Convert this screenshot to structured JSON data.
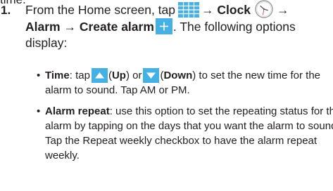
{
  "top_fragment": "time.",
  "step": {
    "number": "1.",
    "line1": {
      "t1": "From the Home screen, tap",
      "arrow1": "→",
      "clock_label": "Clock",
      "arrow2": "→"
    },
    "line2": {
      "alarm_label": "Alarm",
      "arrow": "→",
      "create_label": "Create alarm",
      "tail": ". The following options"
    },
    "line3": "display:",
    "icons": {
      "apps": "apps-grid-icon",
      "clock": "clock-icon",
      "create": "plus-icon",
      "up": "up-arrow-icon",
      "down": "down-arrow-icon"
    },
    "icon_color": "#45b0e3"
  },
  "bullets": {
    "time": {
      "marker": "•",
      "label": "Time",
      "t1": ": tap",
      "up_open": "(",
      "up_label": "Up",
      "up_close": ") or",
      "down_open": "(",
      "down_label": "Down",
      "down_tail": ") to set the new time for the",
      "line2": "alarm to sound. Tap AM or PM."
    },
    "repeat": {
      "marker": "•",
      "label": "Alarm repeat",
      "line1_tail": ": use this option to set the repeating status for the",
      "line2": "alarm by tapping on the days that you want the alarm to sound.",
      "line3": "Tap the Repeat weekly checkbox to have the alarm repeat",
      "line4": "weekly."
    }
  }
}
